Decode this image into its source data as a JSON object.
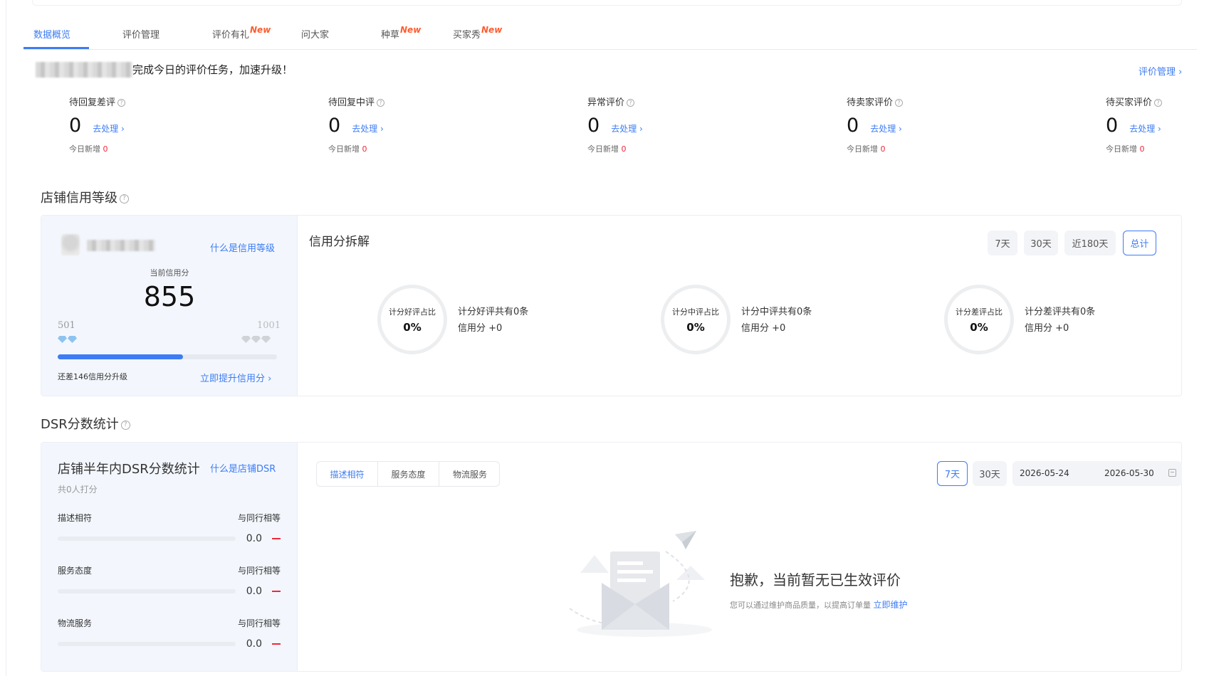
{
  "tabs": [
    {
      "label": "数据概览",
      "new": ""
    },
    {
      "label": "评价管理",
      "new": ""
    },
    {
      "label": "评价有礼",
      "new": "New"
    },
    {
      "label": "问大家",
      "new": ""
    },
    {
      "label": "种草",
      "new": "New"
    },
    {
      "label": "买家秀",
      "new": "New"
    }
  ],
  "notice": "完成今日的评价任务，加速升级！",
  "manage_link": "评价管理 ›",
  "stats": [
    {
      "label": "待回复差评",
      "value": "0",
      "action": "去处理 ›",
      "today_label": "今日新增",
      "today_value": "0"
    },
    {
      "label": "待回复中评",
      "value": "0",
      "action": "去处理 ›",
      "today_label": "今日新增",
      "today_value": "0"
    },
    {
      "label": "异常评价",
      "value": "0",
      "action": "去处理 ›",
      "today_label": "今日新增",
      "today_value": "0"
    },
    {
      "label": "待卖家评价",
      "value": "0",
      "action": "去处理 ›",
      "today_label": "今日新增",
      "today_value": "0"
    },
    {
      "label": "待买家评价",
      "value": "0",
      "action": "去处理 ›",
      "today_label": "今日新增",
      "today_value": "0"
    }
  ],
  "credit": {
    "section_title": "店铺信用等级",
    "what_link": "什么是信用等级",
    "current_label": "当前信用分",
    "score": "855",
    "min": "501",
    "max": "1001",
    "progress": 0.57,
    "upgrade_text": "还差146信用分升级",
    "improve_link": "立即提升信用分 ›",
    "breakdown_title": "信用分拆解",
    "periods": [
      "7天",
      "30天",
      "近180天",
      "总计"
    ],
    "selected_period": "总计",
    "rings": [
      {
        "ring_label": "计分好评占比",
        "ring_value": "0%",
        "desc": "计分好评共有0条",
        "score": "信用分 +0"
      },
      {
        "ring_label": "计分中评占比",
        "ring_value": "0%",
        "desc": "计分中评共有0条",
        "score": "信用分 +0"
      },
      {
        "ring_label": "计分差评占比",
        "ring_value": "0%",
        "desc": "计分差评共有0条",
        "score": "信用分 +0"
      }
    ]
  },
  "dsr": {
    "section_title": "DSR分数统计",
    "panel_title": "店铺半年内DSR分数统计",
    "what_link": "什么是店铺DSR",
    "raters": "共0人打分",
    "rows": [
      {
        "label": "描述相符",
        "compare": "与同行相等",
        "value": "0.0"
      },
      {
        "label": "服务态度",
        "compare": "与同行相等",
        "value": "0.0"
      },
      {
        "label": "物流服务",
        "compare": "与同行相等",
        "value": "0.0"
      }
    ],
    "segments": [
      "描述相符",
      "服务态度",
      "物流服务"
    ],
    "selected_segment": "描述相符",
    "periods": [
      "7天",
      "30天"
    ],
    "selected_period": "7天",
    "date_start": "2026-05-24",
    "date_end": "2026-05-30",
    "empty_title": "抱歉，当前暂无已生效评价",
    "empty_desc": "您可以通过维护商品质量，以提高订单量",
    "empty_link": "立即维护"
  },
  "colors": {
    "accent": "#3d7cf5",
    "new_badge": "#ff5b2d",
    "alert": "#f0283a",
    "panel_bg": "#f3f7fd"
  }
}
